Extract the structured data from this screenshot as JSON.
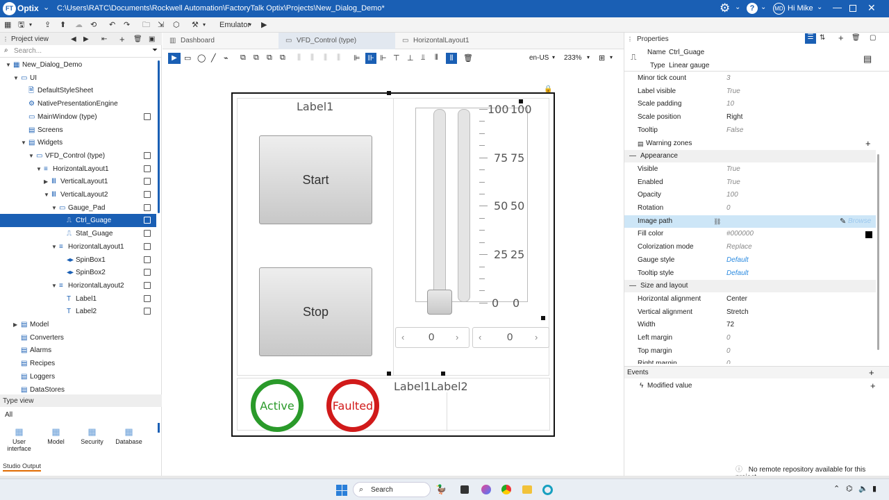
{
  "titlebar": {
    "app": "Optix",
    "path": "C:\\Users\\RATC\\Documents\\Rockwell Automation\\FactoryTalk Optix\\Projects\\New_Dialog_Demo*",
    "user_initials": "MD",
    "user": "Hi Mike"
  },
  "toolbar": {
    "emulator": "Emulator"
  },
  "project_view": {
    "title": "Project view",
    "search_placeholder": "Search...",
    "tree": [
      {
        "label": "New_Dialog_Demo"
      },
      {
        "label": "UI"
      },
      {
        "label": "DefaultStyleSheet"
      },
      {
        "label": "NativePresentationEngine"
      },
      {
        "label": "MainWindow (type)"
      },
      {
        "label": "Screens"
      },
      {
        "label": "Widgets"
      },
      {
        "label": "VFD_Control (type)"
      },
      {
        "label": "HorizontalLayout1"
      },
      {
        "label": "VerticalLayout1"
      },
      {
        "label": "VerticalLayout2"
      },
      {
        "label": "Gauge_Pad"
      },
      {
        "label": "Ctrl_Guage"
      },
      {
        "label": "Stat_Guage"
      },
      {
        "label": "HorizontalLayout1"
      },
      {
        "label": "SpinBox1"
      },
      {
        "label": "SpinBox2"
      },
      {
        "label": "HorizontalLayout2"
      },
      {
        "label": "Label1"
      },
      {
        "label": "Label2"
      },
      {
        "label": "Model"
      },
      {
        "label": "Converters"
      },
      {
        "label": "Alarms"
      },
      {
        "label": "Recipes"
      },
      {
        "label": "Loggers"
      },
      {
        "label": "DataStores"
      }
    ]
  },
  "type_view": {
    "title": "Type view",
    "filter": "All",
    "items": [
      {
        "label": "User interface"
      },
      {
        "label": "Model"
      },
      {
        "label": "Security"
      },
      {
        "label": "Database"
      }
    ]
  },
  "studio_output": "Studio Output",
  "tabs": [
    {
      "label": "Dashboard"
    },
    {
      "label": "VFD_Control (type)"
    },
    {
      "label": "HorizontalLayout1"
    }
  ],
  "editor_toolbar": {
    "locale": "en-US",
    "zoom": "233%"
  },
  "canvas": {
    "label1_top": "Label1",
    "start_button": "Start",
    "stop_button": "Stop",
    "active": "Active",
    "faulted": "Faulted",
    "bottom_labels": "Label1Label2",
    "gauge_ticks": [
      "100",
      "75",
      "50",
      "25",
      "0"
    ],
    "spin1": "0",
    "spin2": "0"
  },
  "properties": {
    "title": "Properties",
    "name_key": "Name",
    "name_value": "Ctrl_Guage",
    "type_key": "Type",
    "type_value": "Linear gauge",
    "rows_top": [
      {
        "key": "Minor tick count",
        "value": "3"
      },
      {
        "key": "Label visible",
        "value": "True"
      },
      {
        "key": "Scale padding",
        "value": "10"
      },
      {
        "key": "Scale position",
        "value": "Right"
      },
      {
        "key": "Tooltip",
        "value": "False"
      },
      {
        "key": "Warning zones",
        "value": ""
      }
    ],
    "appearance_title": "Appearance",
    "appearance": [
      {
        "key": "Visible",
        "value": "True"
      },
      {
        "key": "Enabled",
        "value": "True"
      },
      {
        "key": "Opacity",
        "value": "100"
      },
      {
        "key": "Rotation",
        "value": "0"
      },
      {
        "key": "Image path",
        "value": "Browse"
      },
      {
        "key": "Fill color",
        "value": "#000000"
      },
      {
        "key": "Colorization mode",
        "value": "Replace"
      },
      {
        "key": "Gauge style",
        "value": "Default"
      },
      {
        "key": "Tooltip style",
        "value": "Default"
      }
    ],
    "size_title": "Size and layout",
    "size": [
      {
        "key": "Horizontal alignment",
        "value": "Center"
      },
      {
        "key": "Vertical alignment",
        "value": "Stretch"
      },
      {
        "key": "Width",
        "value": "72"
      },
      {
        "key": "Left margin",
        "value": "0"
      },
      {
        "key": "Top margin",
        "value": "0"
      },
      {
        "key": "Right margin",
        "value": "0"
      }
    ],
    "events_title": "Events",
    "events": [
      {
        "label": "Modified value"
      }
    ]
  },
  "status": {
    "message": "No remote repository available for this project."
  },
  "taskbar": {
    "search": "Search"
  },
  "colors": {
    "accent": "#1a5fb4",
    "active": "#2a9a2a",
    "faulted": "#d11a1a"
  }
}
